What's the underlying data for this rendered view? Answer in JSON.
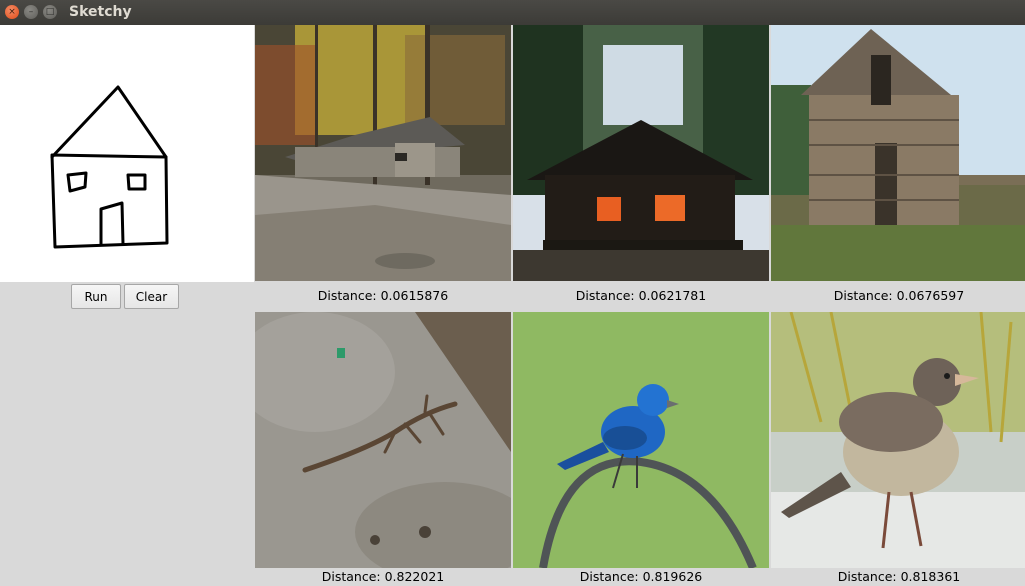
{
  "window": {
    "title": "Sketchy",
    "controls": {
      "close": "×",
      "minimize": "–",
      "maximize": "□"
    }
  },
  "controls": {
    "run_label": "Run",
    "clear_label": "Clear"
  },
  "results": [
    {
      "distance_label": "Distance: 0.0615876",
      "subject": "log cabin in autumn forest"
    },
    {
      "distance_label": "Distance: 0.0621781",
      "subject": "lit cabin at dusk"
    },
    {
      "distance_label": "Distance: 0.0676597",
      "subject": "dilapidated wooden shack"
    },
    {
      "distance_label": "Distance: 0.822021",
      "subject": "lizard on rock"
    },
    {
      "distance_label": "Distance: 0.819626",
      "subject": "blue bird on wire"
    },
    {
      "distance_label": "Distance: 0.818361",
      "subject": "junco bird in snow"
    }
  ]
}
